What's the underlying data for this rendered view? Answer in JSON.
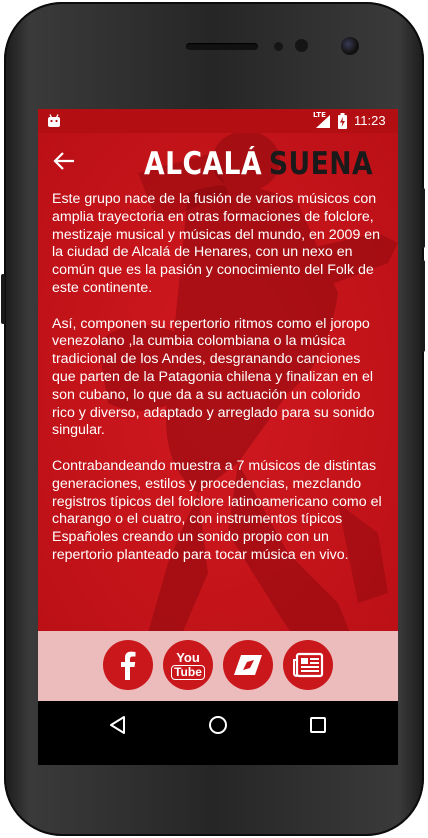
{
  "status_bar": {
    "time": "11:23",
    "network_label": "LTE",
    "icons": [
      "android-notification-icon",
      "lte-signal-icon",
      "battery-charging-icon"
    ]
  },
  "header": {
    "logo_part1": "ALCALÁ",
    "logo_part2": "SUENA",
    "back_icon": "arrow-left-icon"
  },
  "content": {
    "paragraphs": [
      "Este grupo nace de la fusión de varios músicos con amplia trayectoria en otras formaciones de folclore, mestizaje musical y músicas del mundo, en 2009 en la ciudad de Alcalá de Henares, con un nexo en común que es la pasión y conocimiento del Folk de este continente.",
      "Así, componen su repertorio ritmos como el joropo venezolano ,la cumbia colombiana o la música tradicional de los Andes, desgranando canciones que parten de la Patagonia chilena y finalizan en el son cubano, lo que da a su actuación un colorido rico y diverso, adaptado y arreglado para su sonido singular.",
      "Contrabandeando muestra a 7 músicos de distintas generaciones, estilos y procedencias, mezclando registros típicos del folclore latinoamericano como el charango o el cuatro, con instrumentos típicos Españoles creando un sonido propio con un repertorio planteado para tocar música en vivo."
    ]
  },
  "social": {
    "buttons": [
      "facebook-icon",
      "youtube-icon",
      "blog-icon",
      "news-icon"
    ],
    "youtube_you": "You",
    "youtube_tube": "Tube"
  },
  "navigation": {
    "buttons": [
      "back-triangle-icon",
      "home-circle-icon",
      "recents-square-icon"
    ]
  },
  "colors": {
    "primary_red": "#c9171c",
    "status_red": "#b30e12",
    "social_bar": "#ecbcbc",
    "logo_dark": "#1a1a1a"
  }
}
